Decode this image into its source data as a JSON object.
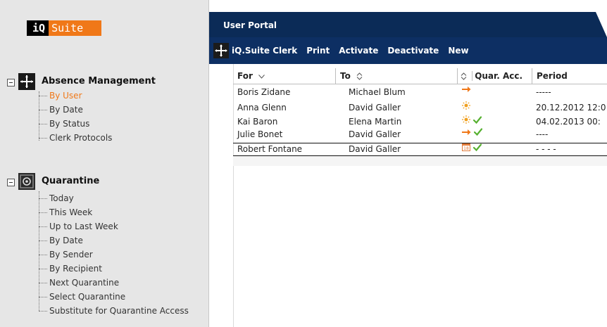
{
  "logo": {
    "prefix": "iQ",
    "brand": "Suite"
  },
  "header": {
    "title": "User Portal"
  },
  "toolbar": {
    "items": [
      "iQ.Suite Clerk",
      "Print",
      "Activate",
      "Deactivate",
      "New"
    ]
  },
  "sidebar": {
    "absence": {
      "title": "Absence Management",
      "items": [
        "By User",
        "By Date",
        "By Status",
        "Clerk Protocols"
      ],
      "active_index": 0
    },
    "quarantine": {
      "title": "Quarantine",
      "items": [
        "Today",
        "This Week",
        "Up to Last Week",
        "By Date",
        "By Sender",
        "By Recipient",
        "Next Quarantine",
        "Select Quarantine",
        "Substitute for Quarantine Access"
      ]
    }
  },
  "table": {
    "columns": [
      "For",
      "To",
      "Quar. Acc.",
      "Period"
    ],
    "sort_icons": {
      "for": "chevron-down-icon",
      "to": "sort-icon",
      "status": "sort-icon"
    },
    "rows": [
      {
        "for": "Boris Zidane",
        "to": "Michael Blum",
        "status": [
          "arrow-right-icon"
        ],
        "period": "-----"
      },
      {
        "for": "Anna Glenn",
        "to": "David Galler",
        "status": [
          "sun-icon"
        ],
        "period": "20.12.2012 12:0"
      },
      {
        "for": "Kai Baron",
        "to": "Elena Martin",
        "status": [
          "sun-icon",
          "check-icon"
        ],
        "period": "04.02.2013 00:"
      },
      {
        "for": "Julie Bonet",
        "to": "David Galler",
        "status": [
          "arrow-right-icon",
          "check-icon"
        ],
        "period": "----"
      },
      {
        "for": "Robert Fontane",
        "to": "David Galler",
        "status": [
          "calendar-icon",
          "check-icon"
        ],
        "period": "- - - -"
      }
    ]
  },
  "colors": {
    "accent": "#f07818",
    "header_bg": "#0b2b57",
    "toolbar_bg": "#0d2f63",
    "sidebar_bg": "#e6e6e6",
    "check": "#56b030"
  }
}
